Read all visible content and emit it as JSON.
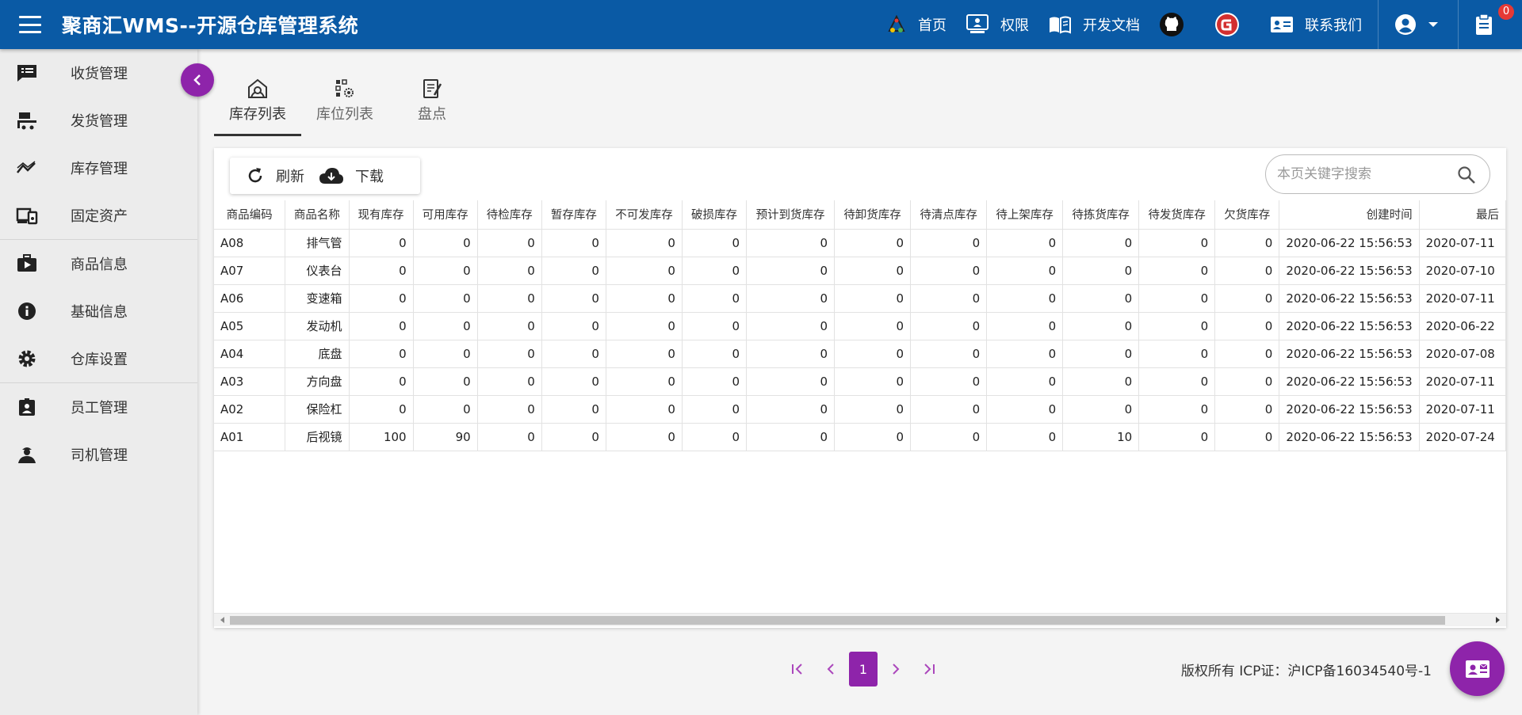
{
  "header": {
    "title": "聚商汇WMS--开源仓库管理系统",
    "nav": {
      "home": "首页",
      "permission": "权限",
      "docs": "开发文档",
      "contact": "联系我们"
    },
    "notification_count": "0",
    "brand_color": "#0a5aa5"
  },
  "sidebar": {
    "items": [
      {
        "label": "收货管理",
        "icon": "receipt-list-icon"
      },
      {
        "label": "发货管理",
        "icon": "truck-loading-icon"
      },
      {
        "label": "库存管理",
        "icon": "trend-chart-icon"
      },
      {
        "label": "固定资产",
        "icon": "devices-icon"
      },
      {
        "label": "商品信息",
        "icon": "product-video-icon"
      },
      {
        "label": "基础信息",
        "icon": "info-icon"
      },
      {
        "label": "仓库设置",
        "icon": "gear-icon"
      },
      {
        "label": "员工管理",
        "icon": "employee-badge-icon"
      },
      {
        "label": "司机管理",
        "icon": "driver-icon"
      }
    ]
  },
  "tabs": [
    {
      "label": "库存列表",
      "active": true
    },
    {
      "label": "库位列表",
      "active": false
    },
    {
      "label": "盘点",
      "active": false
    }
  ],
  "toolbar": {
    "refresh_label": "刷新",
    "download_label": "下载"
  },
  "search": {
    "placeholder": "本页关键字搜索",
    "value": ""
  },
  "table": {
    "columns": [
      "商品编码",
      "商品名称",
      "现有库存",
      "可用库存",
      "待检库存",
      "暂存库存",
      "不可发库存",
      "破损库存",
      "预计到货库存",
      "待卸货库存",
      "待清点库存",
      "待上架库存",
      "待拣货库存",
      "待发货库存",
      "欠货库存",
      "创建时间",
      "最后"
    ],
    "rows": [
      [
        "A08",
        "排气管",
        "0",
        "0",
        "0",
        "0",
        "0",
        "0",
        "0",
        "0",
        "0",
        "0",
        "0",
        "0",
        "0",
        "2020-06-22 15:56:53",
        "2020-07-11"
      ],
      [
        "A07",
        "仪表台",
        "0",
        "0",
        "0",
        "0",
        "0",
        "0",
        "0",
        "0",
        "0",
        "0",
        "0",
        "0",
        "0",
        "2020-06-22 15:56:53",
        "2020-07-10"
      ],
      [
        "A06",
        "变速箱",
        "0",
        "0",
        "0",
        "0",
        "0",
        "0",
        "0",
        "0",
        "0",
        "0",
        "0",
        "0",
        "0",
        "2020-06-22 15:56:53",
        "2020-07-11"
      ],
      [
        "A05",
        "发动机",
        "0",
        "0",
        "0",
        "0",
        "0",
        "0",
        "0",
        "0",
        "0",
        "0",
        "0",
        "0",
        "0",
        "2020-06-22 15:56:53",
        "2020-06-22"
      ],
      [
        "A04",
        "底盘",
        "0",
        "0",
        "0",
        "0",
        "0",
        "0",
        "0",
        "0",
        "0",
        "0",
        "0",
        "0",
        "0",
        "2020-06-22 15:56:53",
        "2020-07-08"
      ],
      [
        "A03",
        "方向盘",
        "0",
        "0",
        "0",
        "0",
        "0",
        "0",
        "0",
        "0",
        "0",
        "0",
        "0",
        "0",
        "0",
        "2020-06-22 15:56:53",
        "2020-07-11"
      ],
      [
        "A02",
        "保险杠",
        "0",
        "0",
        "0",
        "0",
        "0",
        "0",
        "0",
        "0",
        "0",
        "0",
        "0",
        "0",
        "0",
        "2020-06-22 15:56:53",
        "2020-07-11"
      ],
      [
        "A01",
        "后视镜",
        "100",
        "90",
        "0",
        "0",
        "0",
        "0",
        "0",
        "0",
        "0",
        "0",
        "10",
        "0",
        "0",
        "2020-06-22 15:56:53",
        "2020-07-24"
      ]
    ]
  },
  "pagination": {
    "current_page": "1"
  },
  "footer": {
    "copyright": "版权所有 ICP证：沪ICP备16034540号-1"
  },
  "accent_color": "#8e24aa"
}
